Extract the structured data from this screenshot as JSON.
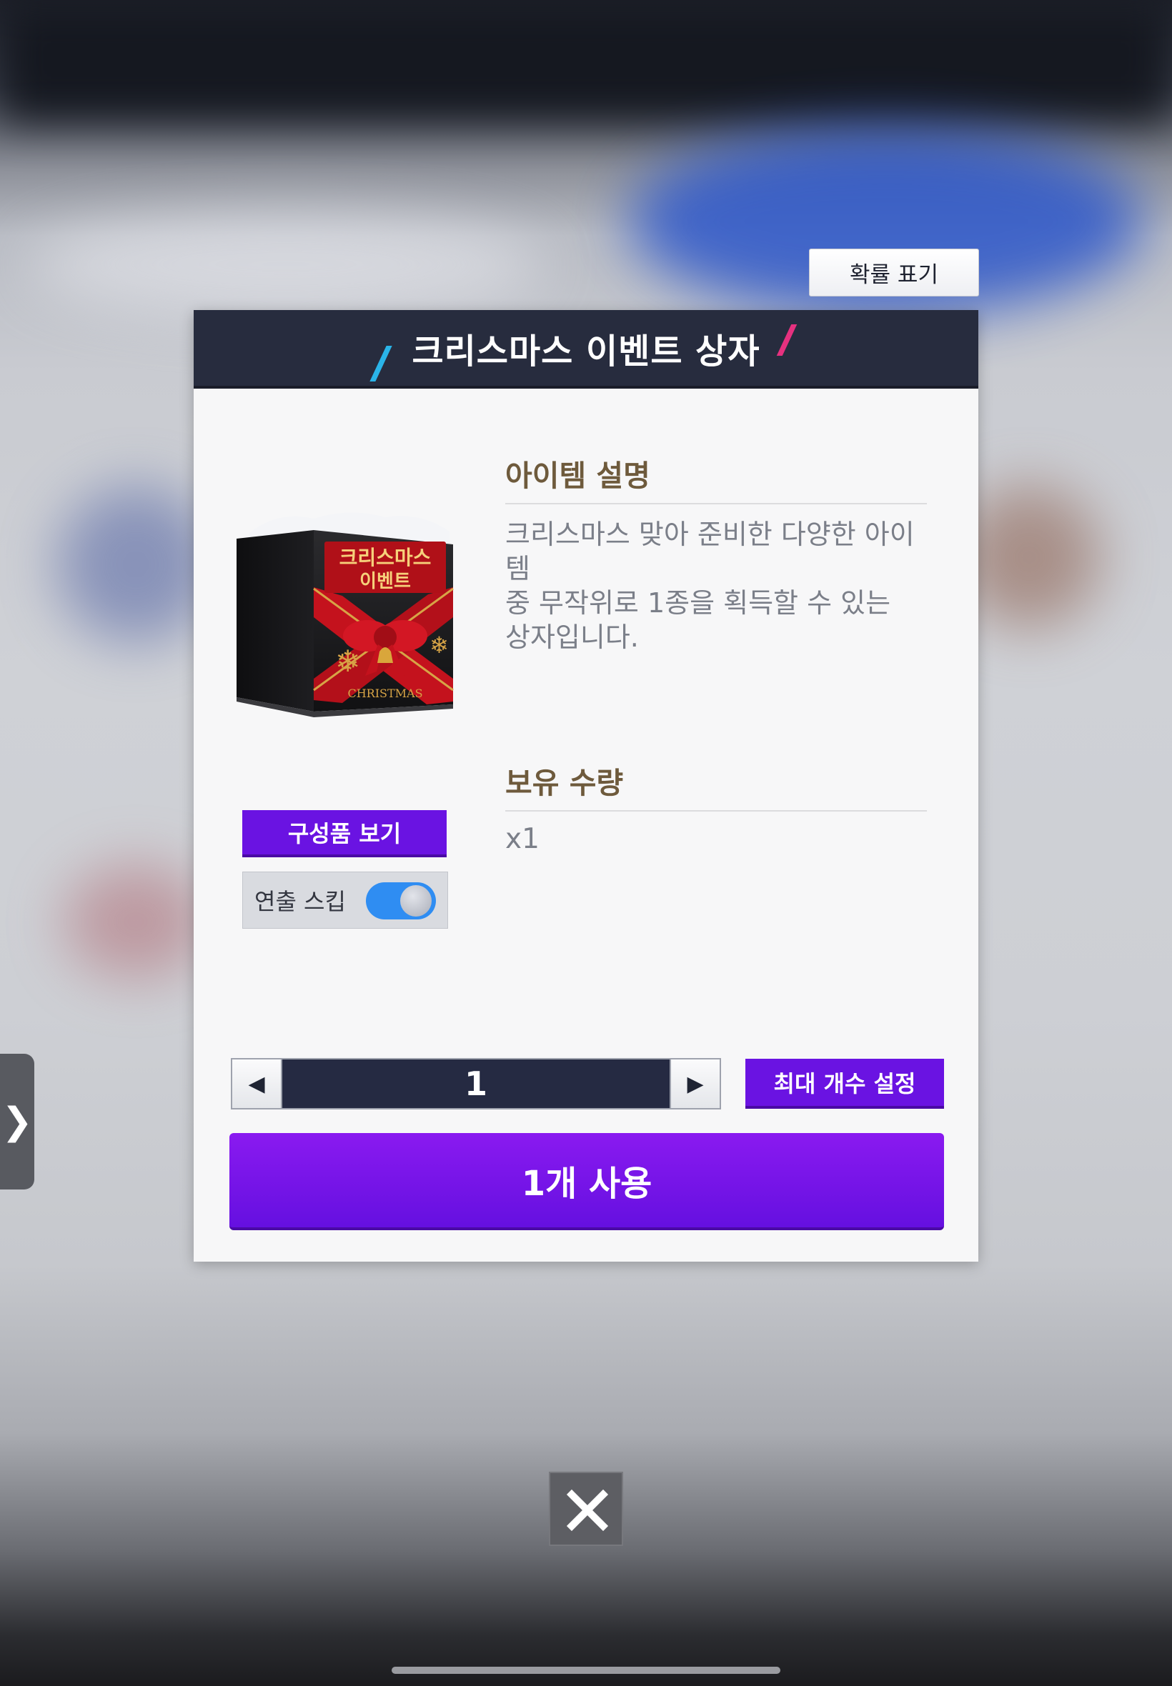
{
  "dialog": {
    "title": "크리스마스 이벤트 상자",
    "probability_button": "확률 표기",
    "description_title": "아이템 설명",
    "description_lines": [
      "크리스마스 맞아 준비한 다양한 아이템",
      "중 무작위로 1종을 획득할 수 있는",
      "상자입니다."
    ],
    "quantity_title": "보유 수량",
    "quantity_value": "x1",
    "components_button": "구성품 보기",
    "skip_label": "연출 스킵",
    "skip_enabled": true,
    "stepper_value": "1",
    "max_button": "최대 개수 설정",
    "use_button": "1개 사용"
  },
  "item_box": {
    "title_line1": "크리스마스",
    "title_line2": "이벤트",
    "subtitle": "CHRISTMAS"
  },
  "icons": {
    "side_handle": "chevron-right-icon",
    "close": "close-icon",
    "decrement": "triangle-left-icon",
    "increment": "triangle-right-icon"
  },
  "colors": {
    "accent_purple": "#6a13e2",
    "header_navy": "#272c3e",
    "section_title_brown": "#6e5a3c",
    "toggle_blue": "#2f8df2"
  }
}
